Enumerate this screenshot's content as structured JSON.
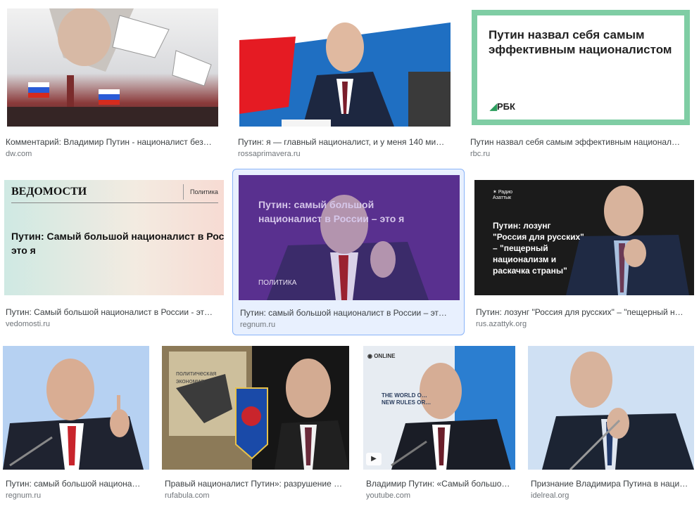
{
  "results": [
    {
      "caption": "Комментарий: Владимир Путин - националист без…",
      "source": "dw.com"
    },
    {
      "caption": "Путин: я — главный националист, и у меня 140 ми…",
      "source": "rossaprimavera.ru"
    },
    {
      "caption": "Путин назвал себя самым эффективным национал…",
      "source": "rbc.ru",
      "overlay": {
        "headline_line1": "Путин назвал себя самым",
        "headline_line2": "эффективным националистом",
        "logo": "РБК"
      }
    },
    {
      "caption": "Путин: Самый большой националист в России - эт…",
      "source": "vedomosti.ru",
      "overlay": {
        "masthead": "ВЕДОМОСТИ",
        "section": "Политика",
        "headline_line1": "Путин: Самый большой националист в России -",
        "headline_line2": "это я"
      }
    },
    {
      "caption": "Путин: самый большой националист в России – эт…",
      "source": "regnum.ru",
      "overlay": {
        "headline_line1": "Путин: самый большой",
        "headline_line2": "националист в России – это я",
        "tag": "ПОЛИТИКА"
      }
    },
    {
      "caption": "Путин: лозунг \"Россия для русских\" – \"пещерный н…",
      "source": "rus.azattyk.org",
      "overlay": {
        "logo": "Радио Азаттык",
        "l1": "Путин: лозунг",
        "l2": "\"Россия для русских\"",
        "l3": "– \"пещерный",
        "l4": "национализм и",
        "l5": "раскачка страны\""
      }
    },
    {
      "caption": "Путин: самый большой национа…",
      "source": "regnum.ru"
    },
    {
      "caption": "Правый националист Путин»: разрушение …",
      "source": "rufabula.com",
      "overlay": {
        "book": "политическая экономия"
      }
    },
    {
      "caption": "Владимир Путин: «Самый большо…",
      "source": "youtube.com",
      "overlay": {
        "channel": "ONLINE",
        "t1": "THE WORLD O…",
        "t2": "NEW RULES OR…"
      }
    },
    {
      "caption": "Признание Владимира Путина в наци…",
      "source": "idelreal.org"
    }
  ],
  "colors": {
    "selected_bg": "#e8f0fe",
    "selected_border": "#8ab4f8",
    "caption": "#3c4043",
    "source": "#70757a"
  }
}
